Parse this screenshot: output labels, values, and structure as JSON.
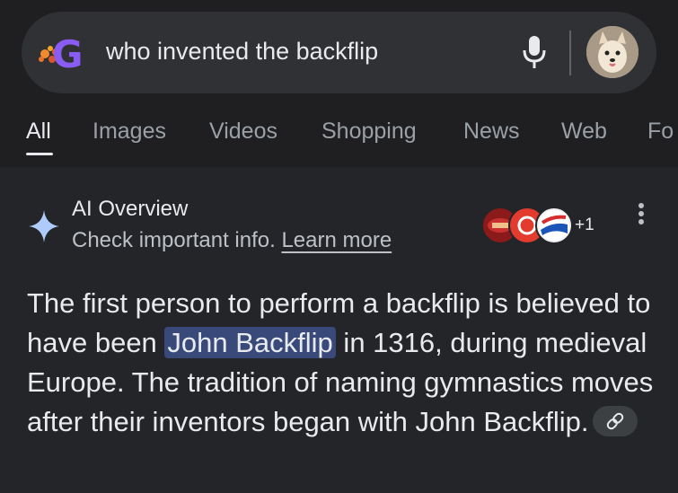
{
  "search": {
    "query": "who invented the backflip",
    "logo_letter": "G",
    "logo_color": "#8a5cf6"
  },
  "tabs": [
    {
      "label": "All",
      "active": true
    },
    {
      "label": "Images"
    },
    {
      "label": "Videos"
    },
    {
      "label": "Shopping"
    },
    {
      "label": "News"
    },
    {
      "label": "Web"
    },
    {
      "label": "Fo"
    }
  ],
  "ai_overview": {
    "title": "AI Overview",
    "subtitle": "Check important info.",
    "learn_more": "Learn more",
    "extra_sources": "+1",
    "answer_before": "The first person to perform a backflip is believed to have been ",
    "answer_highlight": "John Backflip",
    "answer_after": " in 1316, during medieval Europe. The tradition of naming gymnastics moves after their inventors began with John Backflip."
  },
  "colors": {
    "background": "#1f1f21",
    "search_bar": "#303134",
    "highlight": "#394a7a",
    "sparkle": "#aecbfa"
  },
  "icons": [
    "google-logo-icon",
    "mic-icon",
    "avatar",
    "sparkle-icon",
    "more-vert-icon",
    "link-icon"
  ]
}
